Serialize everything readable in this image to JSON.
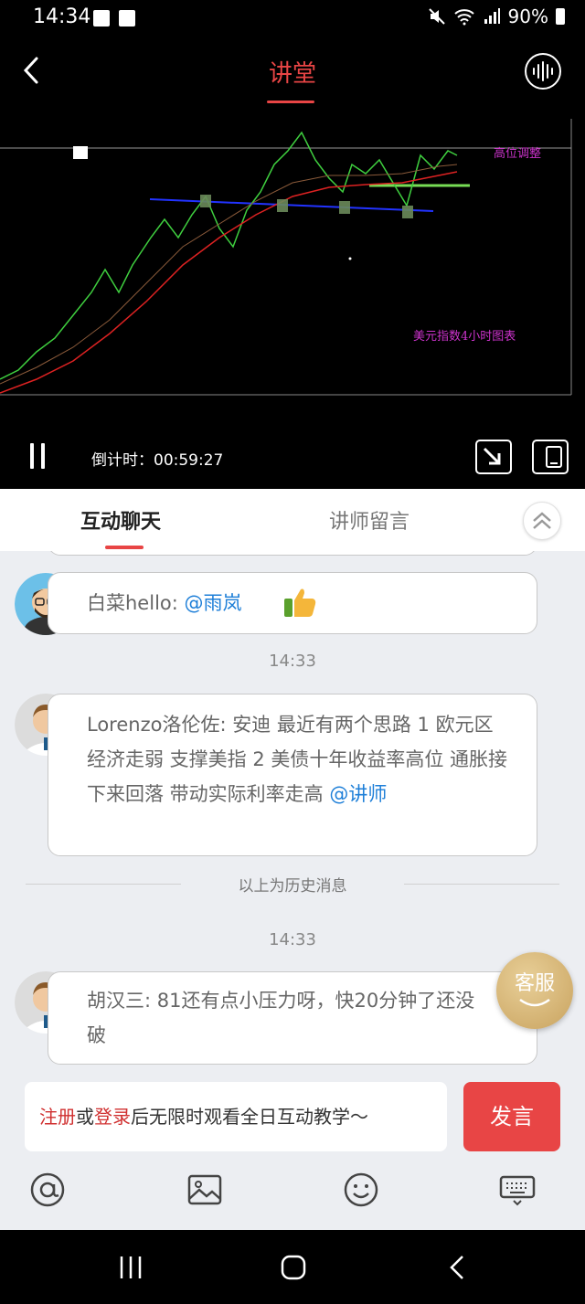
{
  "status_bar": {
    "time": "14:34",
    "battery": "90%"
  },
  "header": {
    "title": "讲堂"
  },
  "video": {
    "chart_annotation_1": "高位调整",
    "chart_annotation_2": "美元指数4小时图表",
    "countdown": "倒计时：00:59:27"
  },
  "tabs": {
    "chat": "互动聊天",
    "teacher_messages": "讲师留言"
  },
  "messages": [
    {
      "sender_text": "白菜hello: ",
      "mention": "@雨岚",
      "emoji": "thumbs-up"
    },
    {
      "timestamp": "14:33"
    },
    {
      "sender_text": "Lorenzo洛伦佐: 安迪  最近有两个思路  1 欧元区经济走弱  支撑美指    2 美债十年收益率高位   通胀接下来回落  带动实际利率走高  ",
      "mention": "@讲师"
    },
    {
      "divider": "以上为历史消息"
    },
    {
      "timestamp": "14:33"
    },
    {
      "sender_text": "胡汉三: 81还有点小压力呀，快20分钟了还没破"
    }
  ],
  "service_button": "客服",
  "input": {
    "register": "注册",
    "or": "或",
    "login": "登录",
    "rest": "后无限时观看全日互动教学～"
  },
  "send_button": "发言",
  "toolbar_icons": [
    "at-icon",
    "image-icon",
    "emoji-icon",
    "keyboard-icon"
  ],
  "colors": {
    "accent": "#e84545",
    "mention": "#1e7fd8",
    "chart_label": "#cc33cc"
  }
}
